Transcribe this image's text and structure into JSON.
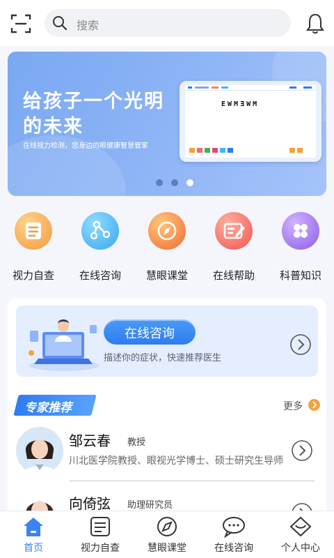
{
  "header": {
    "search_placeholder": "搜索"
  },
  "banner": {
    "title": "给孩子一个光明的未来",
    "subtitle": "在线视力检测，您身边的眼健康智慧管家",
    "screen_text": "EWMƎWM",
    "dots": [
      false,
      false,
      true
    ]
  },
  "quick_nav": [
    {
      "label": "视力自查",
      "icon": "clipboard-icon",
      "color": "#f7a64b"
    },
    {
      "label": "在线咨询",
      "icon": "network-icon",
      "color": "#4fb3f5"
    },
    {
      "label": "慧眼课堂",
      "icon": "compass-icon",
      "color": "#f68a4a"
    },
    {
      "label": "在线帮助",
      "icon": "edit-document-icon",
      "color": "#f56a6a"
    },
    {
      "label": "科普知识",
      "icon": "grid-icon",
      "color": "#9b72e8"
    }
  ],
  "consult": {
    "button_label": "在线咨询",
    "description": "描述你的症状，快速推荐医生"
  },
  "experts": {
    "section_title": "专家推荐",
    "more_label": "更多",
    "doctors": [
      {
        "name": "邹云春",
        "rank": "教授",
        "bio": "川北医学院教授、眼视光学博士、硕士研究生导师"
      },
      {
        "name": "向倚弦",
        "rank": "助理研究员",
        "bio": ""
      }
    ]
  },
  "tabbar": {
    "items": [
      {
        "label": "首页",
        "active": true
      },
      {
        "label": "视力自查",
        "active": false
      },
      {
        "label": "慧眼课堂",
        "active": false
      },
      {
        "label": "在线咨询",
        "active": false
      },
      {
        "label": "个人中心",
        "active": false
      }
    ],
    "active_color": "#3b82f6"
  }
}
